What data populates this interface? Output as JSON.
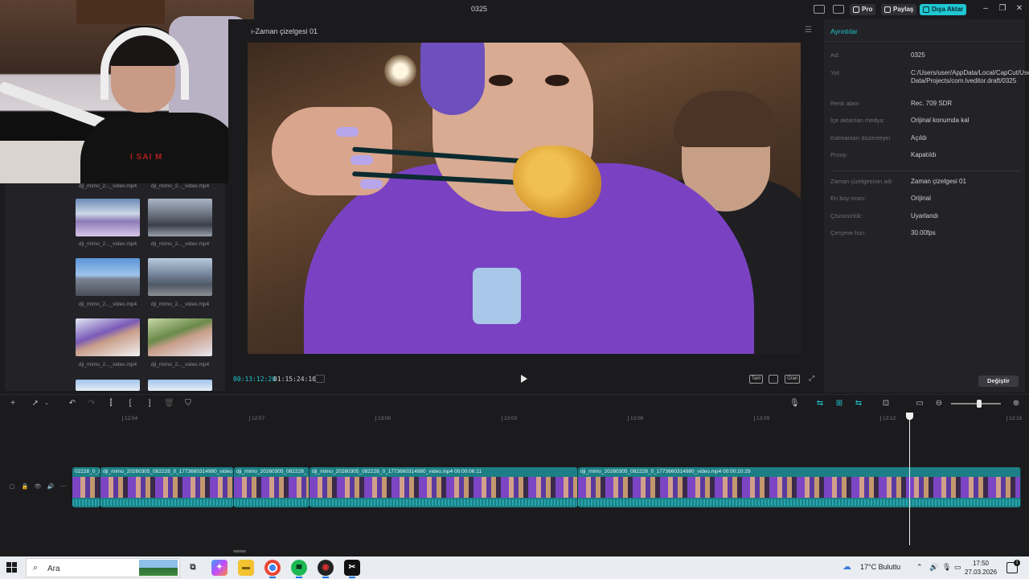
{
  "window": {
    "title": "0325",
    "pro_label": "Pro",
    "share_label": "Paylaş",
    "export_label": "Dışa Aktar",
    "accent": "#1fc7d3"
  },
  "media": {
    "items": [
      {
        "label": "dji_mimo_2..._video.mp4"
      },
      {
        "label": "dji_mimo_2..._video.mp4"
      },
      {
        "label": "dji_mimo_2..._video.mp4"
      },
      {
        "label": "dji_mimo_2..._video.mp4"
      },
      {
        "label": "dji_mimo_2..._video.mp4"
      },
      {
        "label": "dji_mimo_2..._video.mp4"
      },
      {
        "label": "dji_mimo_2..._video.mp4"
      },
      {
        "label": "dji_mimo_2..._video.mp4"
      }
    ]
  },
  "player": {
    "title": "ı-Zaman çizelgesi 01",
    "current_time": "00:13:12:20",
    "total_time": "01:15:24:10",
    "btn_full": "Tam",
    "btn_ratio": "Oran"
  },
  "details": {
    "header": "Ayrıntılar",
    "rows": [
      {
        "key": "Ad:",
        "value": "0325"
      },
      {
        "key": "Yol:",
        "value": "C:/Users/user/AppData/Local/CapCut/User Data/Projects/com.lveditor.draft/0325"
      },
      {
        "key": "Renk alanı",
        "value": "Rec. 709 SDR"
      },
      {
        "key": "İçe aktarılan medya:",
        "value": "Orijinal konumda kal"
      },
      {
        "key": "Katmanları düzenleyin",
        "value": "Açıldı"
      },
      {
        "key": "Proxy:",
        "value": "Kapatıldı"
      },
      {
        "key": "Zaman çizelgesinin adı",
        "value": "Zaman çizelgesi 01"
      },
      {
        "key": "En boy oranı:",
        "value": "Orijinal"
      },
      {
        "key": "Çözünürlük:",
        "value": "Uyarlandı"
      },
      {
        "key": "Çerçeve hızı:",
        "value": "30.00fps"
      }
    ],
    "change_label": "Değiştir"
  },
  "timeline": {
    "ruler": [
      "12:54",
      "12:57",
      "13:00",
      "13:03",
      "13:06",
      "13:09",
      "13:12",
      "13:15"
    ],
    "clips": [
      {
        "label": "02228_0_17"
      },
      {
        "label": "dji_mimo_20260305_082228_0_1773660314980_video"
      },
      {
        "label": "dji_mimo_20260305_082228_"
      },
      {
        "label": "dji_mimo_20260305_082228_0_1773660314980_video.mp4   00:00:06:11"
      },
      {
        "label": "dji_mimo_20260305_082228_0_1773660314980_video.mp4   00:00:10:29"
      }
    ]
  },
  "webcam": {
    "shirt_text": "I SAI   M"
  },
  "taskbar": {
    "search_placeholder": "Ara",
    "weather": "17°C  Bulutlu",
    "time": "17:50",
    "date": "27.03.2026",
    "notif_count": "1"
  }
}
